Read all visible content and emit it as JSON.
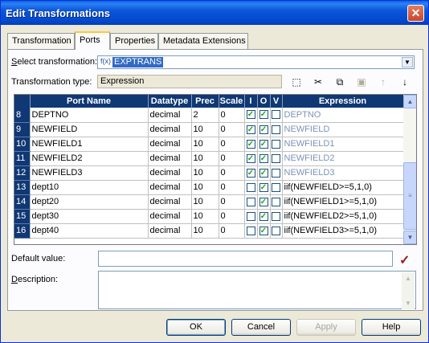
{
  "window": {
    "title": "Edit Transformations",
    "close_icon": "close-icon"
  },
  "tabs": [
    {
      "label": "Transformation"
    },
    {
      "label": "Ports"
    },
    {
      "label": "Properties"
    },
    {
      "label": "Metadata Extensions"
    }
  ],
  "active_tab": "Ports",
  "select_transformation": {
    "label_prefix": "S",
    "label_rest": "elect transformation:",
    "value": "EXPTRANS",
    "icon": "expression-icon"
  },
  "transformation_type": {
    "label": "Transformation type:",
    "value": "Expression"
  },
  "toolbar": [
    "new-port-icon",
    "cut-icon",
    "copy-icon",
    "paste-icon",
    "move-up-icon",
    "move-down-icon"
  ],
  "grid": {
    "columns": [
      "Port Name",
      "Datatype",
      "Prec",
      "Scale",
      "I",
      "O",
      "V",
      "Expression"
    ],
    "rows": [
      {
        "num": "8",
        "name": "DEPTNO",
        "type": "decimal",
        "prec": "2",
        "scale": "0",
        "i": true,
        "o": true,
        "v": false,
        "expr": "DEPTNO"
      },
      {
        "num": "9",
        "name": "NEWFIELD",
        "type": "decimal",
        "prec": "10",
        "scale": "0",
        "i": true,
        "o": true,
        "v": false,
        "expr": "NEWFIELD"
      },
      {
        "num": "10",
        "name": "NEWFIELD1",
        "type": "decimal",
        "prec": "10",
        "scale": "0",
        "i": true,
        "o": true,
        "v": false,
        "expr": "NEWFIELD1"
      },
      {
        "num": "11",
        "name": "NEWFIELD2",
        "type": "decimal",
        "prec": "10",
        "scale": "0",
        "i": true,
        "o": true,
        "v": false,
        "expr": "NEWFIELD2"
      },
      {
        "num": "12",
        "name": "NEWFIELD3",
        "type": "decimal",
        "prec": "10",
        "scale": "0",
        "i": true,
        "o": true,
        "v": false,
        "expr": "NEWFIELD3"
      },
      {
        "num": "13",
        "name": "dept10",
        "type": "decimal",
        "prec": "10",
        "scale": "0",
        "i": false,
        "o": true,
        "v": false,
        "expr": "iif(NEWFIELD>=5,1,0)"
      },
      {
        "num": "14",
        "name": "dept20",
        "type": "decimal",
        "prec": "10",
        "scale": "0",
        "i": false,
        "o": true,
        "v": false,
        "expr": "iif(NEWFIELD1>=5,1,0)"
      },
      {
        "num": "15",
        "name": "dept30",
        "type": "decimal",
        "prec": "10",
        "scale": "0",
        "i": false,
        "o": true,
        "v": false,
        "expr": "iif(NEWFIELD2>=5,1,0)"
      },
      {
        "num": "16",
        "name": "dept40",
        "type": "decimal",
        "prec": "10",
        "scale": "0",
        "i": false,
        "o": true,
        "v": false,
        "expr": "iif(NEWFIELD3>=5,1,0)"
      }
    ]
  },
  "default_value": {
    "label": "Default value:",
    "value": ""
  },
  "description": {
    "label_prefix": "D",
    "label_rest": "escription:",
    "value": ""
  },
  "buttons": {
    "ok": "OK",
    "cancel": "Cancel",
    "apply": "Apply",
    "help": "Help"
  },
  "colors": {
    "header_navy": "#0f3874",
    "expr_gray": "#7d94b6",
    "accent_check": "#21a121"
  }
}
